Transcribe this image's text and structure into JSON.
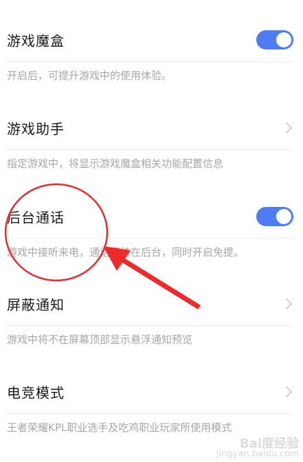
{
  "settings": [
    {
      "title": "游戏魔盒",
      "description": "开启后，可提升游戏中的使用体验。",
      "control": "toggle",
      "on": true
    },
    {
      "title": "游戏助手",
      "description": "指定游戏中，将显示游戏魔盒相关功能配置信息",
      "control": "chevron"
    },
    {
      "title": "后台通话",
      "description": "游戏中接听来电，通话保持在后台，同时开启免提。",
      "control": "toggle",
      "on": true
    },
    {
      "title": "屏蔽通知",
      "description": "游戏中将不在屏幕顶部显示悬浮通知预览",
      "control": "chevron"
    },
    {
      "title": "电竞模式",
      "description": "王者荣耀KPL职业选手及吃鸡职业玩家所使用模式",
      "control": "chevron"
    }
  ],
  "watermark": {
    "brand": "Bai度经验",
    "url": "jingyan.baidu.com"
  },
  "colors": {
    "toggle_on": "#4d7cf5",
    "annotation": "#ee2a2a",
    "description_text": "#a6a6a6"
  },
  "icons": {
    "toggle": "toggle-switch-icon",
    "chevron": "chevron-right-icon"
  }
}
